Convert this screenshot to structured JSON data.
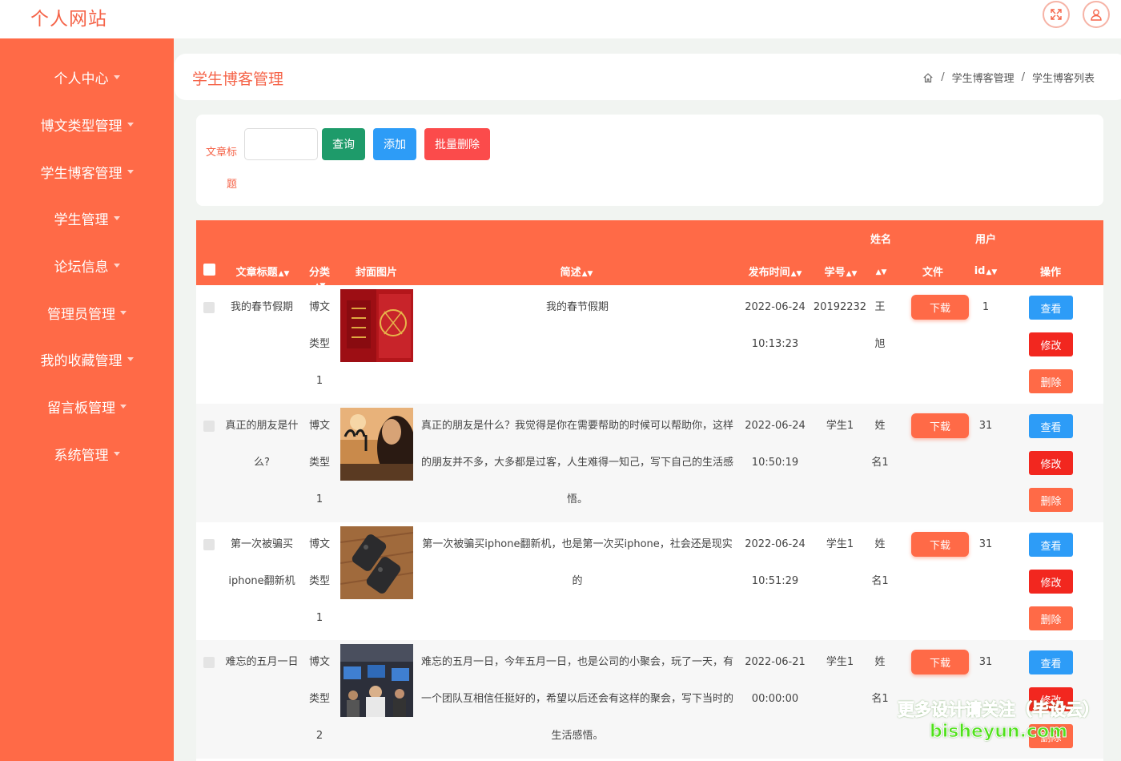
{
  "app": {
    "title": "个人网站",
    "icons": {
      "fullscreen": "fullscreen-icon",
      "user": "user-icon"
    }
  },
  "sidebar": {
    "items": [
      {
        "label": "个人中心"
      },
      {
        "label": "博文类型管理"
      },
      {
        "label": "学生博客管理"
      },
      {
        "label": "学生管理"
      },
      {
        "label": "论坛信息"
      },
      {
        "label": "管理员管理"
      },
      {
        "label": "我的收藏管理"
      },
      {
        "label": "留言板管理"
      },
      {
        "label": "系统管理"
      }
    ]
  },
  "header": {
    "title": "学生博客管理",
    "breadcrumb": [
      "学生博客管理",
      "学生博客列表"
    ],
    "separator": "/"
  },
  "search": {
    "label_line1": "文章标",
    "label_line2": "题",
    "value": "",
    "placeholder": "",
    "query_label": "查询",
    "add_label": "添加",
    "batch_delete_label": "批量删除"
  },
  "table": {
    "headers": {
      "title": "文章标题",
      "category": "分类",
      "cover": "封面图片",
      "summary": "简述",
      "publish_time": "发布时间",
      "student_no": "学号",
      "name": "姓名",
      "file": "文件",
      "user_id_line1": "用户",
      "user_id_line2": "id",
      "actions": "操作"
    },
    "download_label": "下载",
    "view_label": "查看",
    "edit_label": "修改",
    "delete_label": "删除",
    "rows": [
      {
        "title_lines": [
          "我的春节假期"
        ],
        "category_lines": [
          "博文",
          "类型",
          "1"
        ],
        "cover": "red-festival-photo",
        "summary_lines": [
          "我的春节假期"
        ],
        "time_lines": [
          "2022-06-24",
          "10:13:23"
        ],
        "student_no": "20192232",
        "name_lines": [
          "王",
          "旭"
        ],
        "user_id": "1"
      },
      {
        "title_lines": [
          "真正的朋友是什",
          "么?"
        ],
        "category_lines": [
          "博文",
          "类型",
          "1"
        ],
        "cover": "old-friend-photo",
        "summary_lines": [
          "真正的朋友是什么？我觉得是你在需要帮助的时候可以帮助你，这样",
          "的朋友并不多，大多都是过客，人生难得一知己，写下自己的生活感",
          "悟。"
        ],
        "time_lines": [
          "2022-06-24",
          "10:50:19"
        ],
        "student_no": "学生1",
        "name_lines": [
          "姓",
          "名1"
        ],
        "user_id": "31"
      },
      {
        "title_lines": [
          "第一次被骗买",
          "iphone翻新机"
        ],
        "category_lines": [
          "博文",
          "类型",
          "1"
        ],
        "cover": "phones-on-table-photo",
        "summary_lines": [
          "第一次被骗买iphone翻新机，也是第一次买iphone，社会还是现实",
          "的"
        ],
        "time_lines": [
          "2022-06-24",
          "10:51:29"
        ],
        "student_no": "学生1",
        "name_lines": [
          "姓",
          "名1"
        ],
        "user_id": "31"
      },
      {
        "title_lines": [
          "难忘的五月一日"
        ],
        "category_lines": [
          "博文",
          "类型",
          "2"
        ],
        "cover": "office-gathering-photo",
        "summary_lines": [
          "难忘的五月一日，今年五月一日，也是公司的小聚会，玩了一天，有",
          "一个团队互相信任挺好的，希望以后还会有这样的聚会，写下当时的",
          "生活感悟。"
        ],
        "time_lines": [
          "2022-06-21",
          "00:00:00"
        ],
        "student_no": "学生1",
        "name_lines": [
          "姓",
          "名1"
        ],
        "user_id": "31"
      }
    ]
  },
  "watermark": {
    "line1": "更多设计请关注（毕设云）",
    "line2": "bisheyun.com"
  },
  "colors": {
    "accent": "#ff6a47",
    "title": "#f56449",
    "query": "#1e9b6a",
    "add": "#2d9cf7",
    "danger": "#fb4b4b"
  }
}
